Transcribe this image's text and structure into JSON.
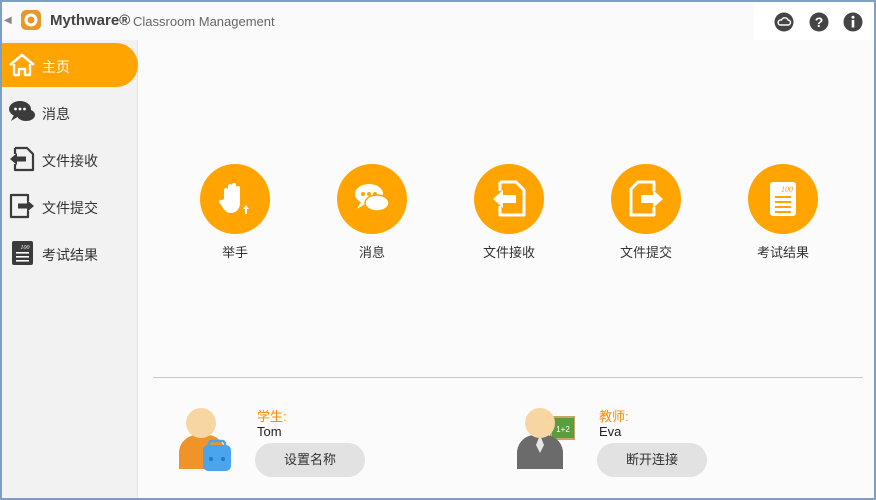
{
  "titlebar": {
    "brand": "Mythware®",
    "product": "Classroom Management"
  },
  "sidebar": {
    "items": [
      {
        "label": "主页",
        "icon": "home-icon",
        "active": true
      },
      {
        "label": "消息",
        "icon": "chat-bubbles-icon",
        "active": false
      },
      {
        "label": "文件接收",
        "icon": "file-receive-icon",
        "active": false
      },
      {
        "label": "文件提交",
        "icon": "file-submit-icon",
        "active": false
      },
      {
        "label": "考试结果",
        "icon": "exam-result-icon",
        "active": false
      }
    ]
  },
  "tiles": [
    {
      "label": "举手",
      "icon": "raise-hand-icon"
    },
    {
      "label": "消息",
      "icon": "chat-bubbles-icon"
    },
    {
      "label": "文件接收",
      "icon": "file-receive-icon"
    },
    {
      "label": "文件提交",
      "icon": "file-submit-icon"
    },
    {
      "label": "考试结果",
      "icon": "exam-result-icon"
    }
  ],
  "student": {
    "role_label": "学生:",
    "name": "Tom",
    "button_label": "设置名称"
  },
  "teacher": {
    "role_label": "教师:",
    "name": "Eva",
    "button_label": "断开连接",
    "board_text": "1+2"
  },
  "colors": {
    "accent": "#ffa400",
    "sidebar_bg": "#f2f2f2",
    "role_text": "#ff8c00",
    "button_bg": "#e2e2e2"
  }
}
